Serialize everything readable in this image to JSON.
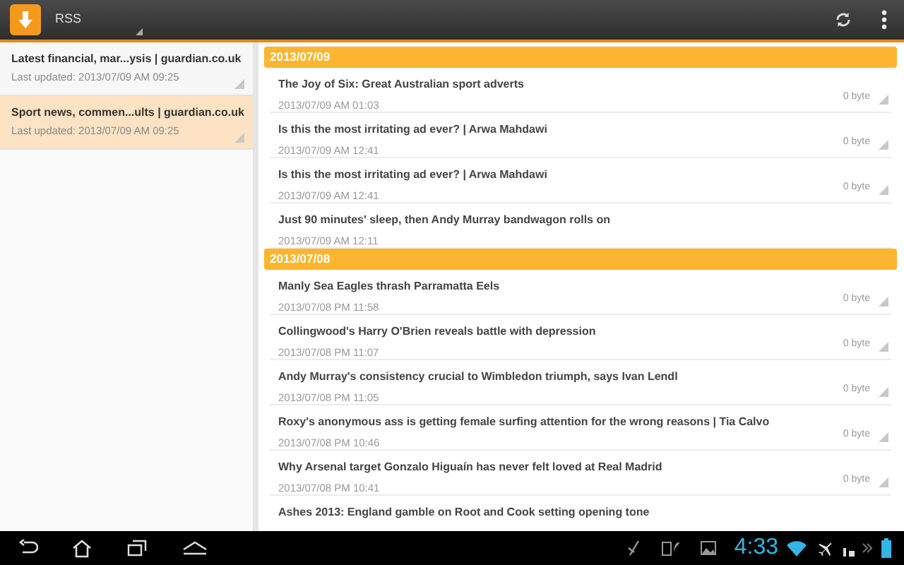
{
  "action_bar": {
    "title": "RSS"
  },
  "feeds": [
    {
      "title": "Latest financial, mar...ysis | guardian.co.uk",
      "updated": "Last updated: 2013/07/09 AM 09:25",
      "selected": false
    },
    {
      "title": "Sport news, commen...ults | guardian.co.uk",
      "updated": "Last updated: 2013/07/09 AM 09:25",
      "selected": true
    }
  ],
  "groups": [
    {
      "date": "2013/07/09",
      "articles": [
        {
          "title": "The Joy of Six: Great Australian sport adverts",
          "time": "2013/07/09 AM 01:03",
          "size": "0 byte"
        },
        {
          "title": "Is this the most irritating ad ever? | Arwa Mahdawi",
          "time": "2013/07/09 AM 12:41",
          "size": "0 byte"
        },
        {
          "title": "Is this the most irritating ad ever? | Arwa Mahdawi",
          "time": "2013/07/09 AM 12:41",
          "size": "0 byte"
        },
        {
          "title": "Just 90 minutes' sleep, then Andy Murray bandwagon rolls on",
          "time": "2013/07/09 AM 12:11"
        }
      ]
    },
    {
      "date": "2013/07/08",
      "articles": [
        {
          "title": "Manly Sea Eagles thrash Parramatta Eels",
          "time": "2013/07/08 PM 11:58",
          "size": "0 byte"
        },
        {
          "title": "Collingwood's Harry O'Brien reveals battle with depression",
          "time": "2013/07/08 PM 11:07",
          "size": "0 byte"
        },
        {
          "title": "Andy Murray's consistency crucial to Wimbledon triumph, says Ivan Lendl",
          "time": "2013/07/08 PM 11:05",
          "size": "0 byte"
        },
        {
          "title": "Roxy's anonymous ass is getting female surfing attention for the wrong reasons | Tia Calvo",
          "time": "2013/07/08 PM 10:46",
          "size": "0 byte"
        },
        {
          "title": "Why Arsenal target Gonzalo Higuaín has never felt loved at Real Madrid",
          "time": "2013/07/08 PM 10:41",
          "size": "0 byte"
        },
        {
          "title": "Ashes 2013: England gamble on Root and Cook setting opening tone"
        }
      ]
    }
  ],
  "system_bar": {
    "time": "4:33"
  }
}
